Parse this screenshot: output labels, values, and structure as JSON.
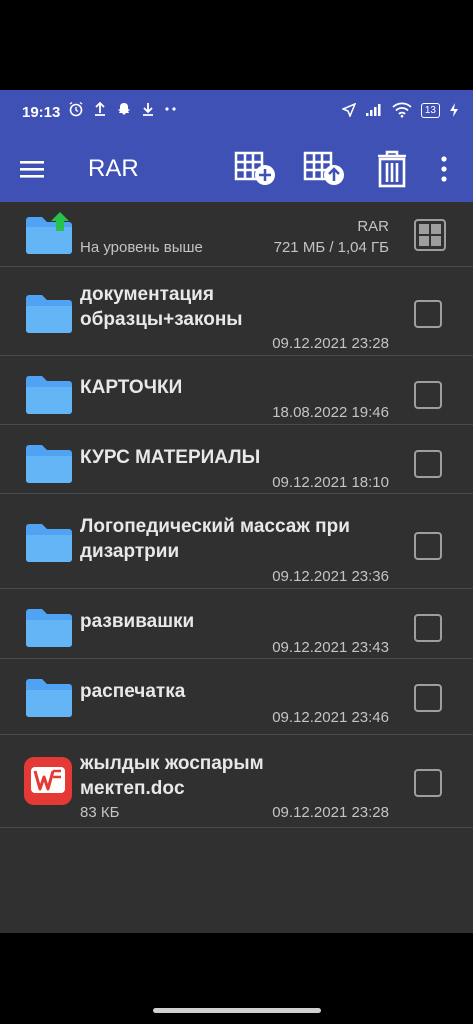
{
  "status_bar": {
    "time": "19:13",
    "battery": "13",
    "icons": [
      "alarm-icon",
      "upload-icon",
      "snapchat-icon",
      "download-icon",
      "more-dots-icon",
      "location-icon",
      "signal-icon",
      "wifi-icon",
      "battery-icon",
      "charging-icon"
    ]
  },
  "app_bar": {
    "title": "RAR",
    "actions": [
      "archive-add-icon",
      "archive-extract-icon",
      "trash-icon",
      "more-vert-icon"
    ],
    "color": "#3f51b5"
  },
  "parent_row": {
    "label": "На уровень выше",
    "path": "RAR",
    "storage": "721 МБ / 1,04 ГБ"
  },
  "items": [
    {
      "name_line1": "документация",
      "name_line2": "образцы+законы",
      "date": "09.12.2021 23:28",
      "size": "",
      "type": "folder"
    },
    {
      "name_line1": "КАРТОЧКИ",
      "name_line2": "",
      "date": "18.08.2022 19:46",
      "size": "",
      "type": "folder"
    },
    {
      "name_line1": "КУРС МАТЕРИАЛЫ",
      "name_line2": "",
      "date": "09.12.2021 18:10",
      "size": "",
      "type": "folder"
    },
    {
      "name_line1": "Логопедический массаж при",
      "name_line2": "дизартрии",
      "date": "09.12.2021 23:36",
      "size": "",
      "type": "folder"
    },
    {
      "name_line1": "развивашки",
      "name_line2": "",
      "date": "09.12.2021 23:43",
      "size": "",
      "type": "folder"
    },
    {
      "name_line1": "распечатка",
      "name_line2": "",
      "date": "09.12.2021 23:46",
      "size": "",
      "type": "folder"
    },
    {
      "name_line1": "жылдык жоспарым",
      "name_line2": "мектеп.doc",
      "date": "09.12.2021 23:28",
      "size": "83 КБ",
      "type": "wps-doc"
    }
  ]
}
